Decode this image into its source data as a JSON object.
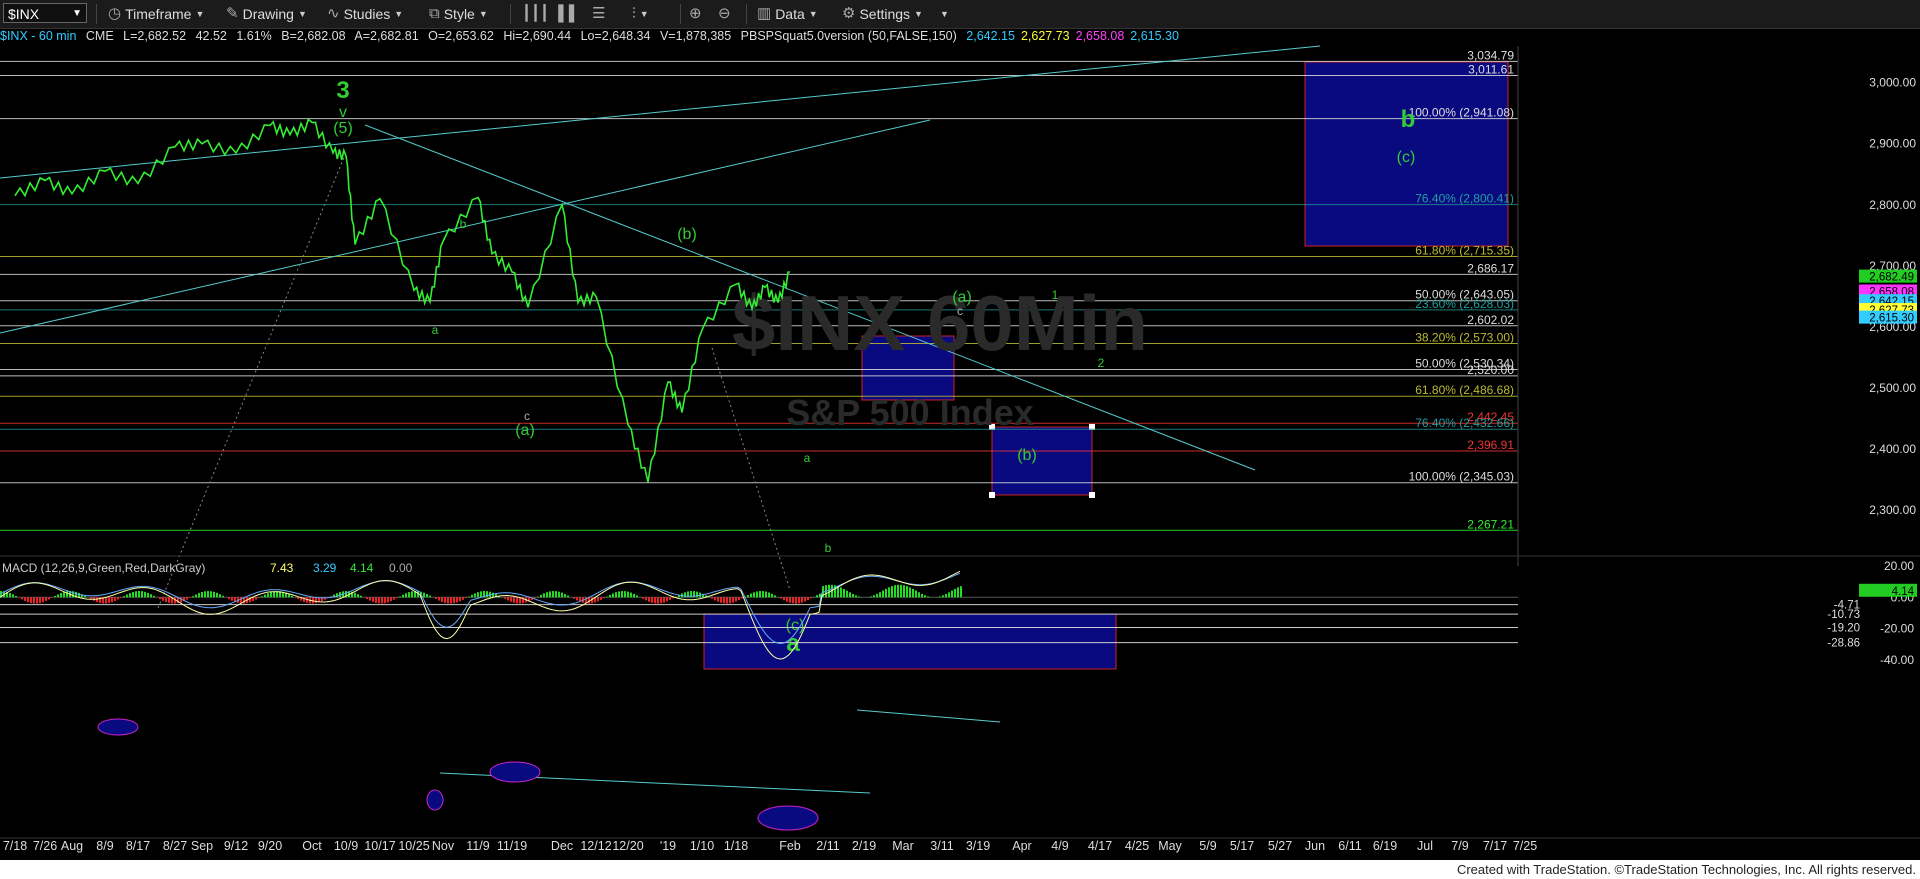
{
  "toolbar": {
    "symbol": "$INX",
    "timeframe": "Timeframe",
    "drawing": "Drawing",
    "studies": "Studies",
    "style": "Style",
    "data": "Data",
    "settings": "Settings"
  },
  "status_bar": {
    "symbol_info": "$INX - 60 min",
    "exchange": "CME",
    "last": "L=2,682.52",
    "change": "42.52",
    "change_pct": "1.61%",
    "bid": "B=2,682.08",
    "ask": "A=2,682.81",
    "open": "O=2,653.62",
    "high": "Hi=2,690.44",
    "low": "Lo=2,648.34",
    "volume": "V=1,878,385",
    "study": "PBSPSquat5.0version (50,FALSE,150)",
    "study_values": [
      {
        "text": "2,642.15",
        "color": "#33ccff"
      },
      {
        "text": "2,627.73",
        "color": "#ffff33"
      },
      {
        "text": "2,658.08",
        "color": "#ff44ff"
      },
      {
        "text": "2,615.30",
        "color": "#33ccff"
      }
    ]
  },
  "watermark": {
    "line1": "$INX 60Min",
    "line2": "S&P 500 Index"
  },
  "footer": "Created with TradeStation. ©TradeStation Technologies, Inc. All rights reserved.",
  "colors": {
    "price": "#33ee33",
    "macd": "#ffffaa",
    "signal": "#66aaff",
    "hist_pos": "#22dd22",
    "hist_neg": "#ee2222",
    "box": "#0a0a80",
    "box_border": "#cc2222"
  },
  "chart_data": {
    "type": "line",
    "price_axis": {
      "min": 2230,
      "max": 3060,
      "ticks": [
        2300,
        2400,
        2500,
        2600,
        2700,
        2800,
        2900,
        3000
      ],
      "tick_labels": [
        "2,300.00",
        "2,400.00",
        "2,500.00",
        "2,600.00",
        "2,700.00",
        "2,800.00",
        "2,900.00",
        "3,000.00"
      ]
    },
    "time_axis": {
      "labels": [
        "7/18",
        "7/26",
        "Aug",
        "8/9",
        "8/17",
        "8/27",
        "Sep",
        "9/12",
        "9/20",
        "Oct",
        "10/9",
        "10/17",
        "10/25",
        "Nov",
        "11/9",
        "11/19",
        "Dec",
        "12/12",
        "12/20",
        "'19",
        "1/10",
        "1/18",
        "Feb",
        "2/11",
        "2/19",
        "Mar",
        "3/11",
        "3/19",
        "Apr",
        "4/9",
        "4/17",
        "4/25",
        "May",
        "5/9",
        "5/17",
        "5/27",
        "Jun",
        "6/11",
        "6/19",
        "Jul",
        "7/9",
        "7/17",
        "7/25"
      ]
    },
    "price_series": {
      "name": "$INX",
      "points": [
        [
          "7/18",
          2815
        ],
        [
          "7/26",
          2840
        ],
        [
          "Aug",
          2818
        ],
        [
          "8/9",
          2855
        ],
        [
          "8/17",
          2835
        ],
        [
          "8/27",
          2895
        ],
        [
          "Sep",
          2900
        ],
        [
          "9/12",
          2885
        ],
        [
          "9/20",
          2930
        ],
        [
          "9/26",
          2915
        ],
        [
          "Oct",
          2935
        ],
        [
          "10/5",
          2885
        ],
        [
          "10/9",
          2880
        ],
        [
          "10/11",
          2735
        ],
        [
          "10/17",
          2810
        ],
        [
          "10/25",
          2660
        ],
        [
          "10/29",
          2641
        ],
        [
          "Nov",
          2740
        ],
        [
          "11/9",
          2812
        ],
        [
          "11/13",
          2720
        ],
        [
          "11/19",
          2690
        ],
        [
          "11/23",
          2632
        ],
        [
          "Dec",
          2800
        ],
        [
          "12/7",
          2640
        ],
        [
          "12/12",
          2650
        ],
        [
          "12/20",
          2440
        ],
        [
          "12/26",
          2346
        ],
        [
          "'19",
          2510
        ],
        [
          "1/4",
          2460
        ],
        [
          "1/10",
          2595
        ],
        [
          "1/18",
          2670
        ],
        [
          "1/22",
          2630
        ],
        [
          "1/25",
          2665
        ],
        [
          "1/28",
          2640
        ],
        [
          "1/30",
          2690
        ]
      ]
    },
    "levels": [
      {
        "value": 3034.79,
        "label": "3,034.79",
        "color": "#dddddd"
      },
      {
        "value": 3011.61,
        "label": "3,011.61",
        "color": "#dddddd"
      },
      {
        "value": 2941.08,
        "label": "100.00% (2,941.08)",
        "color": "#dddddd"
      },
      {
        "value": 2800.41,
        "label": "76.40% (2,800.41)",
        "color": "#1f8f8f"
      },
      {
        "value": 2715.35,
        "label": "61.80% (2,715.35)",
        "color": "#bbbb33"
      },
      {
        "value": 2686.17,
        "label": "2,686.17",
        "color": "#dddddd"
      },
      {
        "value": 2643.05,
        "label": "50.00% (2,643.05)",
        "color": "#dddddd"
      },
      {
        "value": 2628.03,
        "label": "23.60% (2,628.03)",
        "color": "#1f8f8f"
      },
      {
        "value": 2602.02,
        "label": "2,602.02",
        "color": "#dddddd"
      },
      {
        "value": 2573.0,
        "label": "38.20% (2,573.00)",
        "color": "#bbbb33"
      },
      {
        "value": 2530.34,
        "label": "50.00% (2,530.34)",
        "color": "#dddddd"
      },
      {
        "value": 2520.0,
        "label": "2,520.00",
        "color": "#dddddd"
      },
      {
        "value": 2486.68,
        "label": "61.80% (2,486.68)",
        "color": "#bbbb33"
      },
      {
        "value": 2442.45,
        "label": "2,442.45",
        "color": "#ee3333"
      },
      {
        "value": 2432.66,
        "label": "76.40% (2,432.66)",
        "color": "#1f8f8f"
      },
      {
        "value": 2396.91,
        "label": "2,396.91",
        "color": "#ee3333"
      },
      {
        "value": 2345.03,
        "label": "100.00% (2,345.03)",
        "color": "#dddddd"
      },
      {
        "value": 2267.21,
        "label": "2,267.21",
        "color": "#33ee33"
      }
    ],
    "right_tags": [
      {
        "value": 2682.49,
        "label": "2,682.49",
        "bg": "#22cc22",
        "fg": "#000000"
      },
      {
        "value": 2658.08,
        "label": "2,658.08",
        "bg": "#ff33ff",
        "fg": "#000000"
      },
      {
        "value": 2642.15,
        "label": "2,642.15",
        "bg": "#33ccff",
        "fg": "#000000"
      },
      {
        "value": 2627.73,
        "label": "2,627.73",
        "bg": "#ffff33",
        "fg": "#000000"
      },
      {
        "value": 2615.3,
        "label": "2,615.30",
        "bg": "#33ccff",
        "fg": "#000000"
      }
    ],
    "wave_labels": [
      {
        "text": "3",
        "size": "big"
      },
      {
        "text": "v",
        "size": "med"
      },
      {
        "text": "(5)",
        "size": "med"
      },
      {
        "text": "b",
        "size": "small"
      },
      {
        "text": "a",
        "size": "small"
      },
      {
        "text": "c",
        "size": "small"
      },
      {
        "text": "(a)",
        "size": "med"
      },
      {
        "text": "(b)",
        "size": "med"
      },
      {
        "text": "(c)",
        "size": "med"
      },
      {
        "text": "a",
        "size": "big"
      },
      {
        "text": "a",
        "size": "small"
      },
      {
        "text": "b",
        "size": "small"
      },
      {
        "text": "(a)",
        "size": "med"
      },
      {
        "text": "c",
        "size": "small"
      },
      {
        "text": "1",
        "size": "small"
      },
      {
        "text": "2",
        "size": "small"
      },
      {
        "text": "(b)",
        "size": "med"
      },
      {
        "text": "b",
        "size": "big"
      },
      {
        "text": "(c)",
        "size": "med"
      }
    ],
    "macd": {
      "title": "MACD (12,26,9,Green,Red,DarkGray)",
      "values": [
        "7.43",
        "3.29",
        "4.14",
        "0.00"
      ],
      "value_colors": [
        "#ffff66",
        "#33ccff",
        "#33ee33",
        "#aaaaaa"
      ],
      "axis": {
        "min": -45,
        "max": 25,
        "ticks": [
          20,
          0,
          -20,
          -40
        ],
        "tick_labels": [
          "20.00",
          "0.00",
          "-20.00",
          "-40.00"
        ]
      },
      "levels": [
        {
          "value": -4.71,
          "label": "-4.71"
        },
        {
          "value": -10.73,
          "label": "-10.73"
        },
        {
          "value": -19.2,
          "label": "-19.20"
        },
        {
          "value": -28.86,
          "label": "-28.86"
        }
      ],
      "tag": {
        "value": 4.14,
        "label": "4.14",
        "bg": "#22cc22"
      }
    }
  }
}
